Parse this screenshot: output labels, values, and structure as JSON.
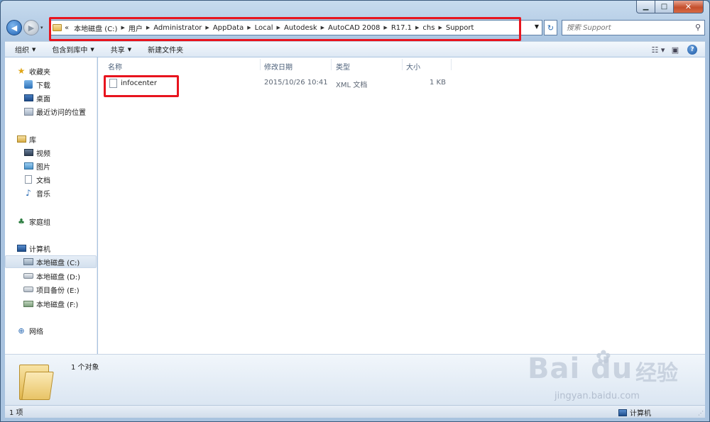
{
  "window": {
    "min_icon": "minimize-icon",
    "max_icon": "maximize-icon",
    "close_icon": "close-icon",
    "min_glyph": "▁",
    "max_glyph": "□",
    "close_glyph": "✕"
  },
  "nav": {
    "back_glyph": "◀",
    "forward_glyph": "▶",
    "history_glyph": "▾",
    "refresh_glyph": "↻"
  },
  "address": {
    "overflow": "«",
    "crumbs": [
      "本地磁盘 (C:)",
      "用户",
      "Administrator",
      "AppData",
      "Local",
      "Autodesk",
      "AutoCAD 2008",
      "R17.1",
      "chs",
      "Support"
    ],
    "separator": "▶",
    "dropdown": "▼"
  },
  "search": {
    "placeholder": "搜索 Support",
    "icon": "search-icon",
    "glyph": "⚲"
  },
  "toolbar": {
    "organize": "组织",
    "include_library": "包含到库中",
    "share": "共享",
    "new_folder": "新建文件夹",
    "arrow": "▼",
    "view_glyph": "☷ ▾",
    "preview_glyph": "▣",
    "help_glyph": "?"
  },
  "sidebar": {
    "favorites": "收藏夹",
    "downloads": "下载",
    "desktop": "桌面",
    "recent": "最近访问的位置",
    "libraries": "库",
    "videos": "视频",
    "pictures": "图片",
    "documents": "文档",
    "music": "音乐",
    "homegroup": "家庭组",
    "computer": "计算机",
    "drive_c": "本地磁盘 (C:)",
    "drive_d": "本地磁盘 (D:)",
    "drive_e": "项目备份 (E:)",
    "drive_f": "本地磁盘 (F:)",
    "network": "网络",
    "star_glyph": "★",
    "note_glyph": "♪",
    "home_glyph": "♣",
    "net_glyph": "⊕"
  },
  "columns": {
    "name": "名称",
    "modified": "修改日期",
    "type": "类型",
    "size": "大小"
  },
  "files": [
    {
      "name": "infocenter",
      "modified": "2015/10/26 10:41",
      "type": "XML 文档",
      "size": "1 KB"
    }
  ],
  "details": {
    "count_text": "1 个对象"
  },
  "status": {
    "item_count": "1 项",
    "location": "计算机",
    "grip": "⋰"
  },
  "watermark": {
    "logo": "Bai  du",
    "paw": "✿",
    "jingyan": "经验",
    "url": "jingyan.baidu.com"
  },
  "colors": {
    "highlight": "#e8141e",
    "accent": "#2e6fb5"
  }
}
